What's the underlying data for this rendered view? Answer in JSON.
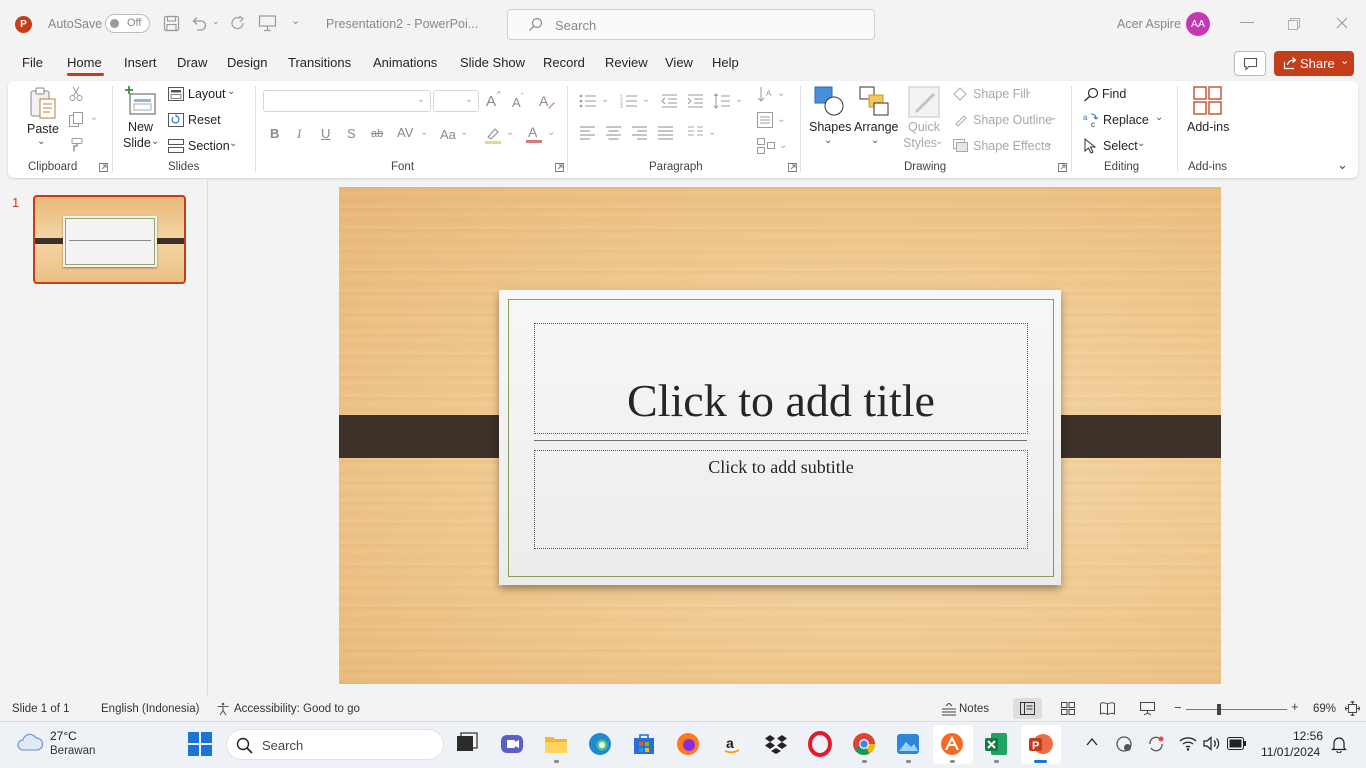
{
  "titlebar": {
    "autosave_label": "AutoSave",
    "autosave_state": "Off",
    "doc_title": "Presentation2 - PowerPoi...",
    "search_placeholder": "Search",
    "user_name": "Acer Aspire",
    "user_initials": "AA"
  },
  "menu": {
    "tabs": [
      "File",
      "Home",
      "Insert",
      "Draw",
      "Design",
      "Transitions",
      "Animations",
      "Slide Show",
      "Record",
      "Review",
      "View",
      "Help"
    ],
    "active_tab": "Home",
    "share_label": "Share"
  },
  "ribbon": {
    "clipboard": {
      "paste": "Paste",
      "label": "Clipboard"
    },
    "slides": {
      "new_slide_1": "New",
      "new_slide_2": "Slide",
      "layout": "Layout",
      "reset": "Reset",
      "section": "Section",
      "label": "Slides"
    },
    "font": {
      "bold": "B",
      "italic": "I",
      "underline": "U",
      "shadow": "S",
      "strike": "ab",
      "spacing": "AV",
      "case": "Aa",
      "color": "A",
      "grow": "A",
      "shrink": "A",
      "label": "Font"
    },
    "paragraph": {
      "label": "Paragraph"
    },
    "drawing": {
      "shapes": "Shapes",
      "arrange": "Arrange",
      "quick_styles_1": "Quick",
      "quick_styles_2": "Styles",
      "shape_fill": "Shape Fill",
      "shape_outline": "Shape Outline",
      "shape_effects": "Shape Effects",
      "label": "Drawing"
    },
    "editing": {
      "find": "Find",
      "replace": "Replace",
      "select": "Select",
      "label": "Editing"
    },
    "addins": {
      "addins": "Add-ins",
      "label": "Add-ins"
    }
  },
  "thumbnails": {
    "slide_number": "1"
  },
  "slide": {
    "title_placeholder": "Click to add title",
    "subtitle_placeholder": "Click to add subtitle"
  },
  "status": {
    "slide_info": "Slide 1 of 1",
    "language": "English (Indonesia)",
    "accessibility": "Accessibility: Good to go",
    "notes": "Notes",
    "zoom": "69%",
    "zoom_level": 0.69
  },
  "taskbar": {
    "weather_temp": "27°C",
    "weather_desc": "Berawan",
    "search_label": "Search",
    "time": "12:56",
    "date": "11/01/2024"
  },
  "colors": {
    "accent": "#c43e1c",
    "share_bg": "#c43e1c",
    "avatar_bg": "#c239b3",
    "strap": "#3d3129"
  }
}
